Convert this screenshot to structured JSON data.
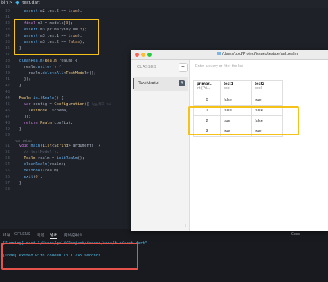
{
  "breadcrumb": {
    "folder": "bin",
    "separator": ">",
    "file": "test.dart"
  },
  "code": {
    "lines": [
      {
        "n": "30",
        "t": "    assert(m2.test2 == true);"
      },
      {
        "n": "31",
        "t": ""
      },
      {
        "n": "32",
        "t": "    final m3 = models[3];"
      },
      {
        "n": "33",
        "t": "    assert(m3.primaryKey == 3);"
      },
      {
        "n": "34",
        "t": "    assert(m3.test1 == true);"
      },
      {
        "n": "35",
        "t": "    assert(m3.test2 == false);"
      },
      {
        "n": "36",
        "t": "  }"
      },
      {
        "n": "37",
        "t": ""
      },
      {
        "n": "38",
        "t": "  cleanRealm(Realm realm) {"
      },
      {
        "n": "39",
        "t": "    realm.write(() {"
      },
      {
        "n": "40",
        "t": "      realm.deleteAll<TestModel>();"
      },
      {
        "n": "41",
        "t": "    });"
      },
      {
        "n": "42",
        "t": "  }"
      },
      {
        "n": "43",
        "t": ""
      },
      {
        "n": "44",
        "t": "  Realm initRealm() {"
      },
      {
        "n": "45",
        "t": "    var config = Configuration(["
      },
      {
        "n": "46",
        "t": "      TestModel.schema,"
      },
      {
        "n": "47",
        "t": "    ]);"
      },
      {
        "n": "48",
        "t": "    return Realm(config);"
      },
      {
        "n": "49",
        "t": "  }"
      },
      {
        "n": "50",
        "t": ""
      },
      {
        "n": "51",
        "t": "  void main(List<String> arguments) {"
      },
      {
        "n": "52",
        "t": "    // testModel();"
      },
      {
        "n": "53",
        "t": "    Realm realm = initRealm();"
      },
      {
        "n": "54",
        "t": "    cleanRealm(realm);"
      },
      {
        "n": "55",
        "t": "    testBool(realm);"
      },
      {
        "n": "56",
        "t": "    exit(0);"
      },
      {
        "n": "57",
        "t": "  }"
      },
      {
        "n": "58",
        "t": ""
      }
    ],
    "codelens": "Run | Debug",
    "inline_hint": "kgg, 昨天 • Init"
  },
  "panel": {
    "tabs": [
      "终端",
      "GITLENS",
      "问题",
      "输出",
      "调试控制台"
    ],
    "active_tab": "输出",
    "channel": "Code",
    "output": [
      "[Running] dart \"/Users/gold/Project/issues/test/bin/test.dart\"",
      "",
      "[Done] exited with code=0 in 1.245 seconds"
    ]
  },
  "realm": {
    "title": "/Users/gold/Project/issues/test/default.realm",
    "classes_header": "CLASSES",
    "add_label": "+",
    "selected_class": "TestModel",
    "selected_count": "4",
    "query_placeholder": "Enter a query or filter the list",
    "columns": [
      {
        "name": "primar...",
        "type": "int (Pri..."
      },
      {
        "name": "test1",
        "type": "bool"
      },
      {
        "name": "test2",
        "type": "bool"
      }
    ],
    "rows": [
      [
        "0",
        "false",
        "true"
      ],
      [
        "1",
        "false",
        "false"
      ],
      [
        "2",
        "true",
        "false"
      ],
      [
        "3",
        "true",
        "true"
      ]
    ],
    "collapse_icon": "‹"
  },
  "colors": {
    "highlight_yellow": "#f4c21a",
    "highlight_red": "#e5534b",
    "traffic_red": "#ff5f57",
    "traffic_yellow": "#febc2e",
    "traffic_green": "#28c840"
  }
}
